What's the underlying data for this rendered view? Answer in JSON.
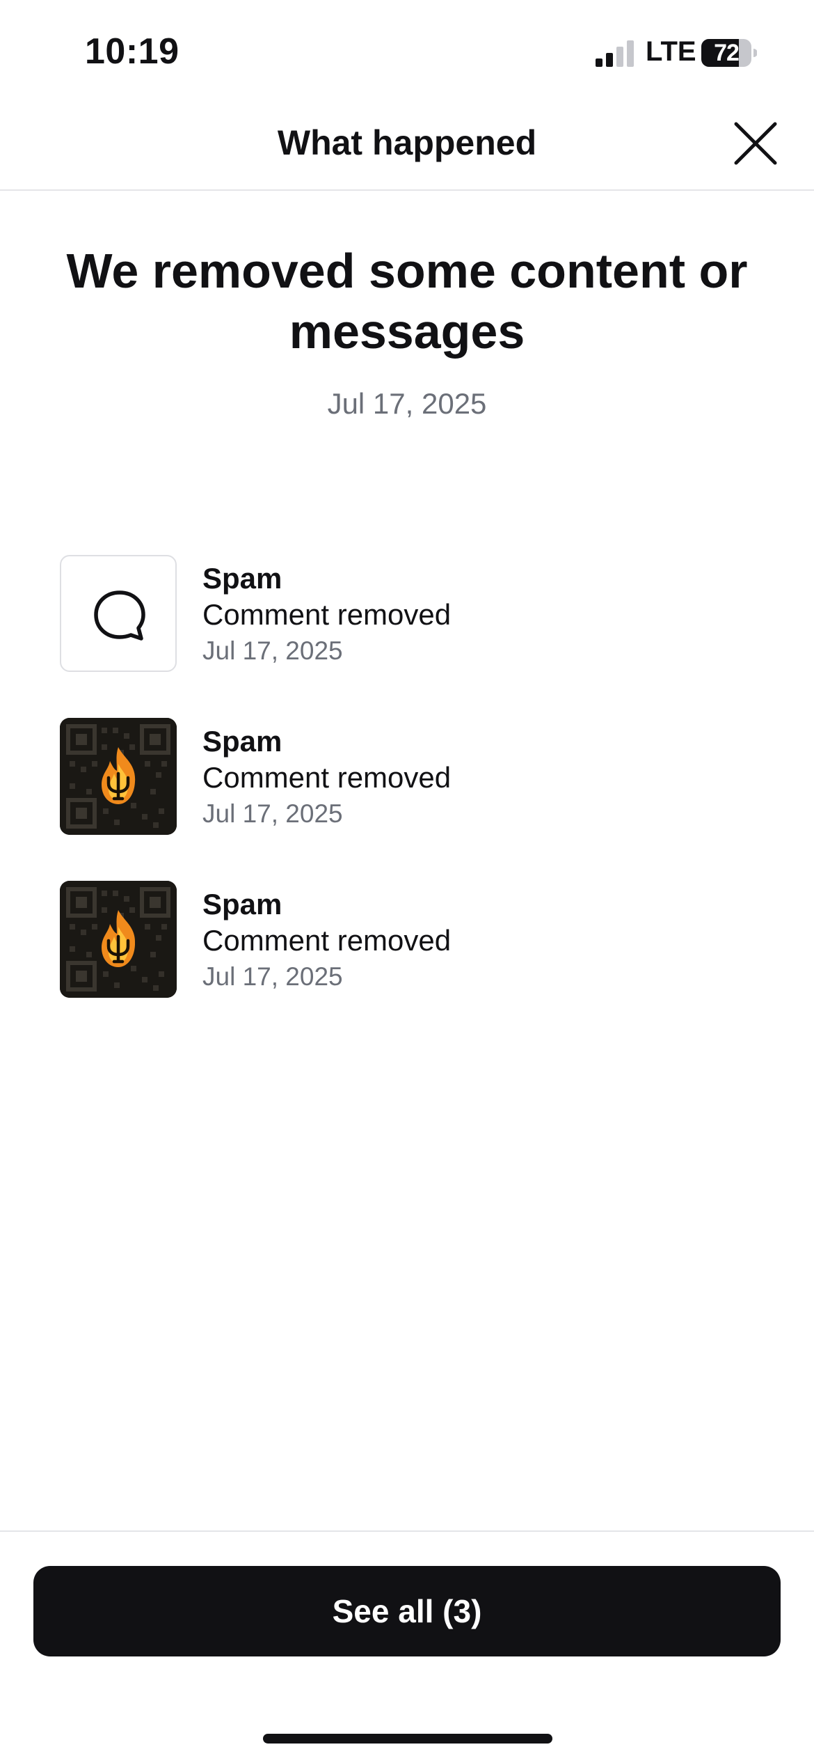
{
  "status_bar": {
    "time": "10:19",
    "network": "LTE",
    "battery": "72"
  },
  "header": {
    "title": "What happened"
  },
  "hero": {
    "title": "We removed some content or messages",
    "date": "Jul 17, 2025"
  },
  "items": [
    {
      "thumbnail": "comment-bubble-icon",
      "reason": "Spam",
      "action": "Comment removed",
      "date": "Jul 17, 2025"
    },
    {
      "thumbnail": "qr-code-flame-image",
      "reason": "Spam",
      "action": "Comment removed",
      "date": "Jul 17, 2025"
    },
    {
      "thumbnail": "qr-code-flame-image",
      "reason": "Spam",
      "action": "Comment removed",
      "date": "Jul 17, 2025"
    }
  ],
  "footer": {
    "see_all_label": "See all (3)"
  },
  "colors": {
    "text_primary": "#111114",
    "text_secondary": "#6b6f78",
    "button_bg": "#111114",
    "divider": "#e4e5e8"
  }
}
